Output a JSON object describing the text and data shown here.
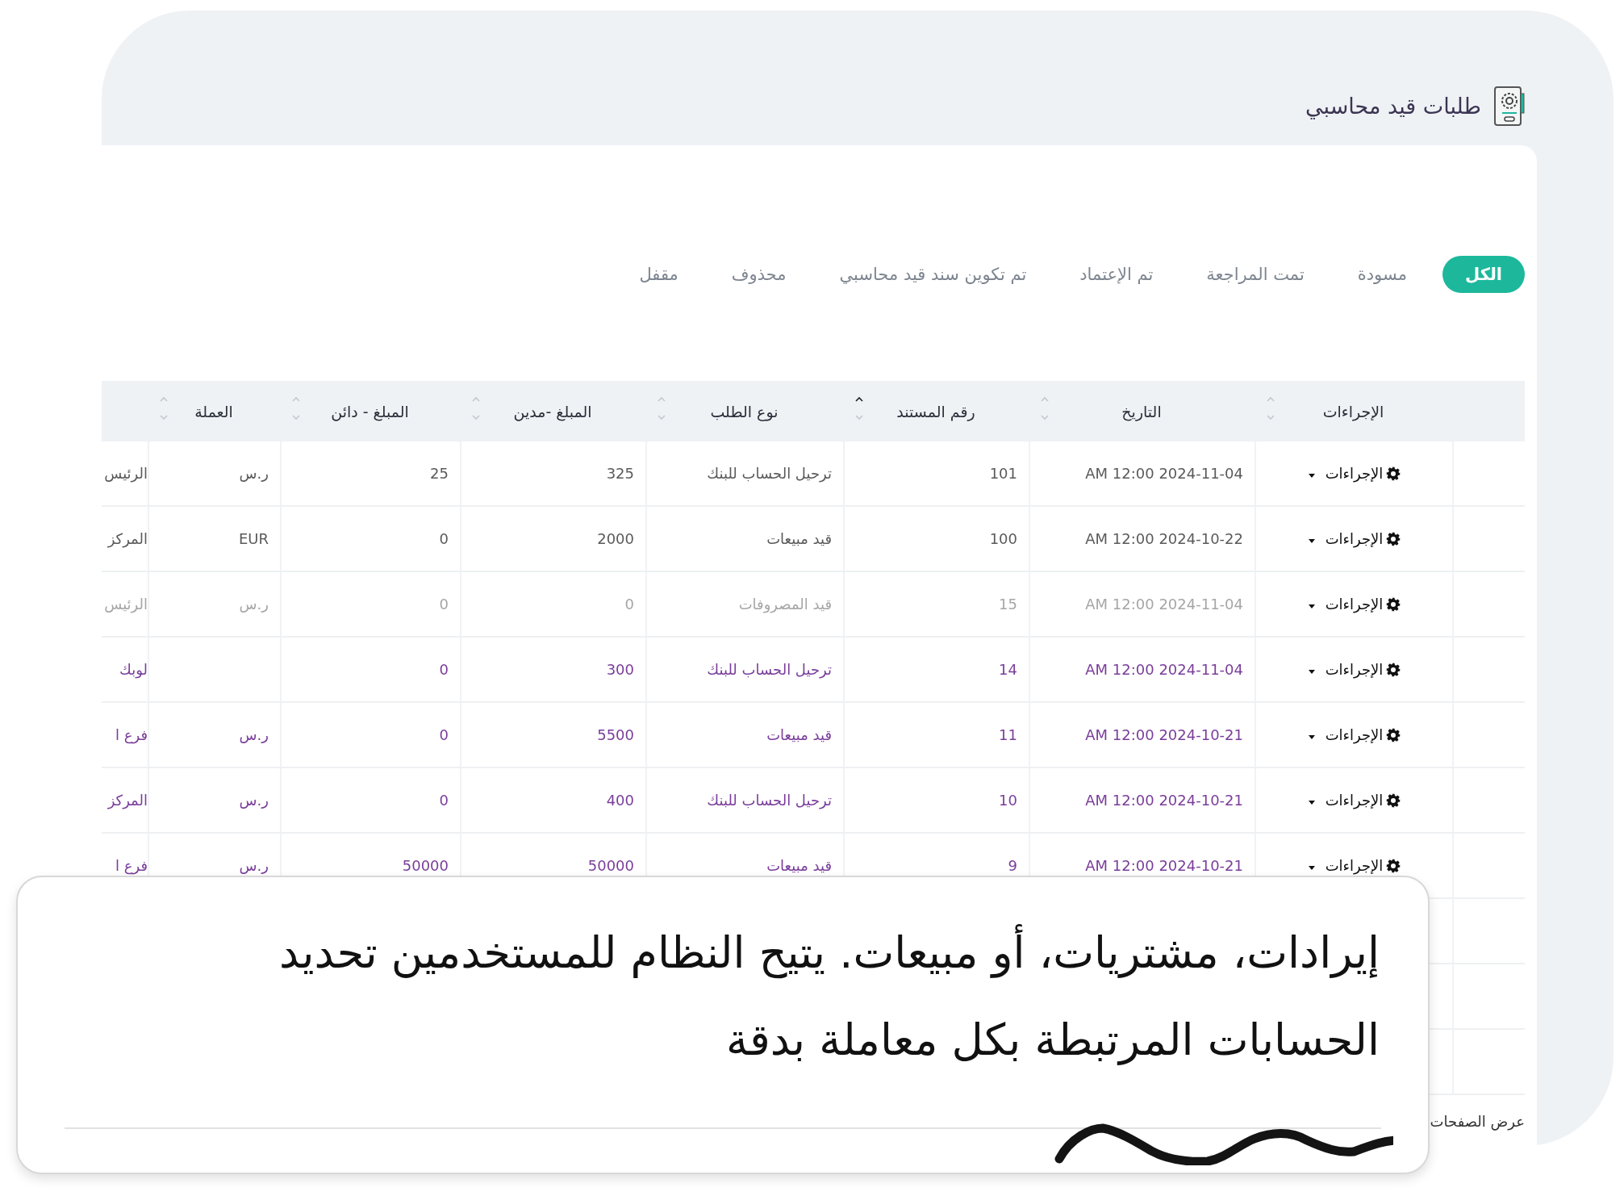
{
  "page_title": "طلبات قيد محاسبي",
  "tabs": [
    {
      "label": "الكل",
      "selected": true
    },
    {
      "label": "مسودة",
      "selected": false
    },
    {
      "label": "تمت المراجعة",
      "selected": false
    },
    {
      "label": "تم الإعتماد",
      "selected": false
    },
    {
      "label": "تم تكوين سند قيد محاسبي",
      "selected": false
    },
    {
      "label": "محذوف",
      "selected": false
    },
    {
      "label": "مقفل",
      "selected": false
    }
  ],
  "table": {
    "columns": [
      {
        "label": "الإجراءات",
        "sorted": false
      },
      {
        "label": "التاريخ",
        "sorted": false
      },
      {
        "label": "رقم المستند",
        "sorted": true
      },
      {
        "label": "نوع الطلب",
        "sorted": false
      },
      {
        "label": "المبلغ -مدين",
        "sorted": false
      },
      {
        "label": "المبلغ - دائن",
        "sorted": false
      },
      {
        "label": "العملة",
        "sorted": false
      }
    ],
    "rows": [
      {
        "color": "#5a5a5a",
        "action": "الإجراءات",
        "date": "2024-11-04 12:00 AM",
        "doc_no": "101",
        "type": "ترحيل الحساب للبنك",
        "debit": "325",
        "credit": "25",
        "currency": "ر.س",
        "column_8": "الرئيس"
      },
      {
        "color": "#5a5a5a",
        "action": "الإجراءات",
        "date": "2024-10-22 12:00 AM",
        "doc_no": "100",
        "type": "قيد مبيعات",
        "debit": "2000",
        "credit": "0",
        "currency": "EUR",
        "column_8": "المركز"
      },
      {
        "color": "#a6a6a6",
        "action": "الإجراءات",
        "date": "2024-11-04 12:00 AM",
        "doc_no": "15",
        "type": "قيد المصروفات",
        "debit": "0",
        "credit": "0",
        "currency": "ر.س",
        "column_8": "الرئيس"
      },
      {
        "color": "#7a3d9a",
        "action": "الإجراءات",
        "date": "2024-11-04 12:00 AM",
        "doc_no": "14",
        "type": "ترحيل الحساب للبنك",
        "debit": "300",
        "credit": "0",
        "column_8": "لوبك"
      },
      {
        "color": "#7a3d9a",
        "action": "الإجراءات",
        "date": "2024-10-21 12:00 AM",
        "doc_no": "11",
        "type": "قيد مبيعات",
        "debit": "5500",
        "credit": "0",
        "currency": "ر.س",
        "column_8": "فرع ا"
      },
      {
        "color": "#7a3d9a",
        "action": "الإجراءات",
        "date": "2024-10-21 12:00 AM",
        "doc_no": "10",
        "type": "ترحيل الحساب للبنك",
        "debit": "400",
        "credit": "0",
        "currency": "ر.س",
        "column_8": "المركز"
      },
      {
        "color": "#7a3d9a",
        "action": "الإجراءات",
        "date": "2024-10-21 12:00 AM",
        "doc_no": "9",
        "type": "قيد مبيعات",
        "debit": "50000",
        "credit": "50000",
        "currency": "ر.س",
        "column_8": "فرع ا"
      }
    ]
  },
  "pagination_label": "عرض الصفحات",
  "callout": {
    "text": "إيرادات، مشتريات، أو مبيعات. يتيح النظام للمستخدمين تحديد الحسابات المرتبطة بكل معاملة بدقة"
  }
}
